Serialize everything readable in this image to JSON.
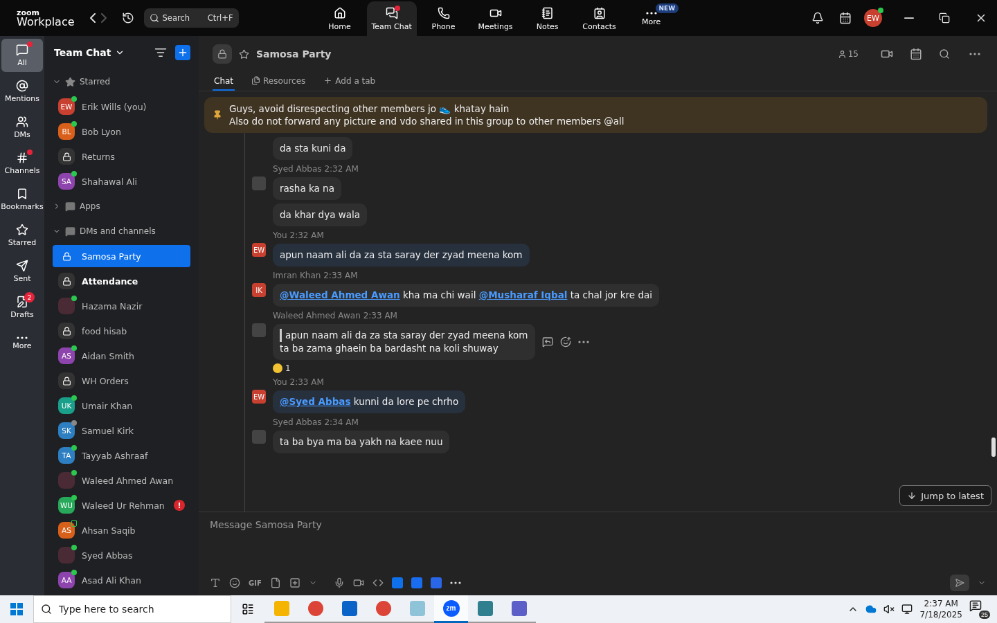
{
  "top_bar": {
    "logo_top": "zoom",
    "logo_bottom": "Workplace",
    "search": {
      "placeholder": "Search",
      "shortcut": "Ctrl+F"
    },
    "nav": [
      {
        "kind": "home",
        "label": "Home",
        "selected": false,
        "dot": false
      },
      {
        "kind": "chat",
        "label": "Team Chat",
        "selected": true,
        "dot": true
      },
      {
        "kind": "phone",
        "label": "Phone",
        "selected": false,
        "dot": false
      },
      {
        "kind": "meetings",
        "label": "Meetings",
        "selected": false,
        "dot": false
      },
      {
        "kind": "notes",
        "label": "Notes",
        "selected": false,
        "dot": false
      },
      {
        "kind": "contacts",
        "label": "Contacts",
        "selected": false,
        "dot": false
      },
      {
        "kind": "more",
        "label": "More",
        "selected": false,
        "dot": false,
        "badge": "NEW"
      }
    ],
    "avatar": "EW"
  },
  "rail": [
    {
      "kind": "all",
      "label": "All",
      "selected": true,
      "dot": true
    },
    {
      "kind": "mentions",
      "label": "Mentions",
      "selected": false,
      "dot": false
    },
    {
      "kind": "dms",
      "label": "DMs",
      "selected": false,
      "dot": false
    },
    {
      "kind": "channels",
      "label": "Channels",
      "selected": false,
      "dot": true
    },
    {
      "kind": "bookmarks",
      "label": "Bookmarks",
      "selected": false,
      "dot": false
    },
    {
      "kind": "starred",
      "label": "Starred",
      "selected": false,
      "dot": false
    },
    {
      "kind": "sent",
      "label": "Sent",
      "selected": false,
      "dot": false
    },
    {
      "kind": "drafts",
      "label": "Drafts",
      "selected": false,
      "dot": false,
      "badge": "2"
    },
    {
      "kind": "more",
      "label": "More",
      "selected": false,
      "dot": false
    }
  ],
  "sidebar": {
    "title": "Team Chat",
    "sections": [
      {
        "kind": "starred",
        "label": "Starred",
        "expanded": true,
        "items": [
          {
            "kind": "person",
            "name": "Erik Wills (you)",
            "initials": "EW",
            "color": "#c8402f",
            "online": true,
            "selected": false,
            "unread": false
          },
          {
            "kind": "person",
            "name": "Bob Lyon",
            "initials": "BL",
            "color": "#d9601a",
            "online": true,
            "selected": false,
            "unread": false
          },
          {
            "kind": "channel",
            "name": "Returns",
            "selected": false,
            "unread": false
          },
          {
            "kind": "person",
            "name": "Shahawal Ali",
            "initials": "SA",
            "color": "#8e44ad",
            "online": true,
            "selected": false,
            "unread": false
          }
        ]
      },
      {
        "kind": "apps",
        "label": "Apps",
        "expanded": false
      },
      {
        "kind": "dms",
        "label": "DMs and channels",
        "expanded": true,
        "items": [
          {
            "kind": "channel",
            "name": "Samosa Party",
            "selected": true,
            "unread": false
          },
          {
            "kind": "channel",
            "name": "Attendance",
            "selected": false,
            "unread": true
          },
          {
            "kind": "photo",
            "name": "Hazama Nazir",
            "online": true,
            "selected": false,
            "unread": false
          },
          {
            "kind": "channel",
            "name": "food hisab",
            "selected": false,
            "unread": false
          },
          {
            "kind": "person",
            "name": "Aidan Smith",
            "initials": "AS",
            "color": "#8e44ad",
            "online": true,
            "selected": false,
            "unread": false
          },
          {
            "kind": "channel",
            "name": "WH Orders",
            "selected": false,
            "unread": false
          },
          {
            "kind": "person",
            "name": "Umair Khan",
            "initials": "UK",
            "color": "#1a9f8a",
            "online": true,
            "selected": false,
            "unread": false
          },
          {
            "kind": "person",
            "name": "Samuel Kirk",
            "initials": "SK",
            "color": "#2d7fc1",
            "online": false,
            "selected": false,
            "unread": false
          },
          {
            "kind": "person",
            "name": "Tayyab Ashraaf",
            "initials": "TA",
            "color": "#2d7fc1",
            "online": true,
            "selected": false,
            "unread": false
          },
          {
            "kind": "photo",
            "name": "Waleed Ahmed Awan",
            "online": true,
            "selected": false,
            "unread": false
          },
          {
            "kind": "person",
            "name": "Waleed Ur Rehman",
            "initials": "WU",
            "color": "#27a85a",
            "online": true,
            "selected": false,
            "unread": false,
            "alert": "!"
          },
          {
            "kind": "person",
            "name": "Ahsan Saqib",
            "initials": "AS",
            "color": "#d9601a",
            "online": true,
            "mobile": true,
            "selected": false,
            "unread": false
          },
          {
            "kind": "photo",
            "name": "Syed Abbas",
            "online": true,
            "selected": false,
            "unread": false
          },
          {
            "kind": "person",
            "name": "Asad Ali Khan",
            "initials": "AA",
            "color": "#8e44ad",
            "online": true,
            "selected": false,
            "unread": false
          }
        ]
      }
    ]
  },
  "chat": {
    "title": "Samosa Party",
    "members": "15",
    "tabs": [
      {
        "kind": "chat",
        "label": "Chat",
        "selected": true
      },
      {
        "kind": "resources",
        "label": "Resources",
        "selected": false
      },
      {
        "kind": "add",
        "label": "Add a tab",
        "selected": false
      }
    ],
    "pinned": [
      "Guys, avoid disrespecting other members jo 👟 khatay hain",
      "Also do not forward any picture and vdo shared in this group to other members @all"
    ],
    "messages": [
      {
        "kind": "continuation",
        "mine": false,
        "bubbles": [
          [
            {
              "kind": "text",
              "text": "da sta kuni da"
            }
          ]
        ]
      },
      {
        "sender": "Syed Abbas",
        "time": "2:32 AM",
        "kind": "photo",
        "mine": false,
        "bubbles": [
          [
            {
              "kind": "text",
              "text": "rasha ka na"
            }
          ],
          [
            {
              "kind": "text",
              "text": "da khar dya wala"
            }
          ]
        ]
      },
      {
        "sender": "You",
        "time": "2:32 AM",
        "kind": "initials",
        "initials": "EW",
        "mine": true,
        "bubbles": [
          [
            {
              "kind": "text",
              "text": "apun naam ali da za sta saray der zyad meena kom"
            }
          ]
        ]
      },
      {
        "sender": "Imran Khan",
        "time": "2:33 AM",
        "kind": "initials",
        "initials": "IK",
        "mine": false,
        "bubbles": [
          [
            {
              "kind": "mention",
              "text": "@Waleed Ahmed Awan"
            },
            {
              "kind": "text",
              "text": " kha ma chi wail "
            },
            {
              "kind": "mention",
              "text": "@Musharaf Iqbal"
            },
            {
              "kind": "text",
              "text": " ta chal jor kre dai"
            }
          ]
        ]
      },
      {
        "sender": "Waleed Ahmed Awan",
        "time": "2:33 AM",
        "kind": "photo",
        "mine": false,
        "quote": "apun naam ali da za sta saray der zyad meena kom",
        "hover": true,
        "bubbles": [
          [
            {
              "kind": "text",
              "text": "ta ba zama ghaein ba bardasht na koli shuway"
            }
          ]
        ],
        "reaction": "1"
      },
      {
        "sender": "You",
        "time": "2:33 AM",
        "kind": "initials",
        "initials": "EW",
        "mine": true,
        "bubbles": [
          [
            {
              "kind": "mention",
              "text": "@Syed Abbas"
            },
            {
              "kind": "text",
              "text": " kunni da lore pe chrho"
            }
          ]
        ]
      },
      {
        "sender": "Syed Abbas",
        "time": "2:34 AM",
        "kind": "photo",
        "mine": false,
        "bubbles": [
          [
            {
              "kind": "text",
              "text": "ta ba bya ma ba yakh na kaee nuu"
            }
          ]
        ]
      }
    ],
    "jump": "Jump to latest",
    "composer": {
      "placeholder": "Message Samosa Party",
      "gif": "GIF"
    }
  },
  "taskbar": {
    "search": "Type here to search",
    "apps": [
      {
        "kind": "folder",
        "selected": false
      },
      {
        "kind": "browser",
        "selected": false
      },
      {
        "kind": "mail",
        "selected": false
      },
      {
        "kind": "browser",
        "selected": false
      },
      {
        "kind": "notepad",
        "selected": false
      },
      {
        "kind": "zoom",
        "label": "zm",
        "selected": true
      },
      {
        "kind": "app",
        "selected": false
      },
      {
        "kind": "teams",
        "selected": false
      }
    ],
    "time": "2:37 AM",
    "date": "7/18/2025",
    "notifications": "25"
  }
}
